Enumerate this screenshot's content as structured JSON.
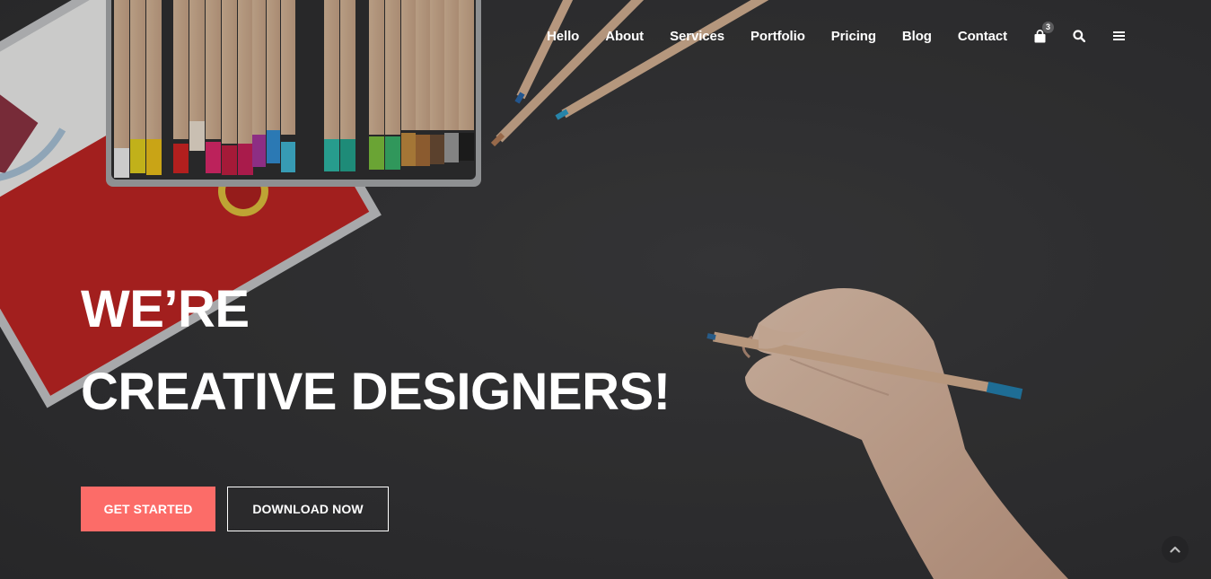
{
  "nav": {
    "items": [
      {
        "label": "Hello"
      },
      {
        "label": "About"
      },
      {
        "label": "Services"
      },
      {
        "label": "Portfolio"
      },
      {
        "label": "Pricing"
      },
      {
        "label": "Blog"
      },
      {
        "label": "Contact"
      }
    ],
    "cart_count": "3",
    "icons": [
      "shopping-bag-icon",
      "search-icon",
      "menu-icon"
    ]
  },
  "hero": {
    "headline_line1": "WE’RE",
    "headline_line2": "CREATIVE DESIGNERS!",
    "primary_button": "GET STARTED",
    "secondary_button": "DOWNLOAD NOW"
  },
  "colors": {
    "accent": "#fc6c68",
    "background": "#2f2f31",
    "text": "#ffffff"
  }
}
